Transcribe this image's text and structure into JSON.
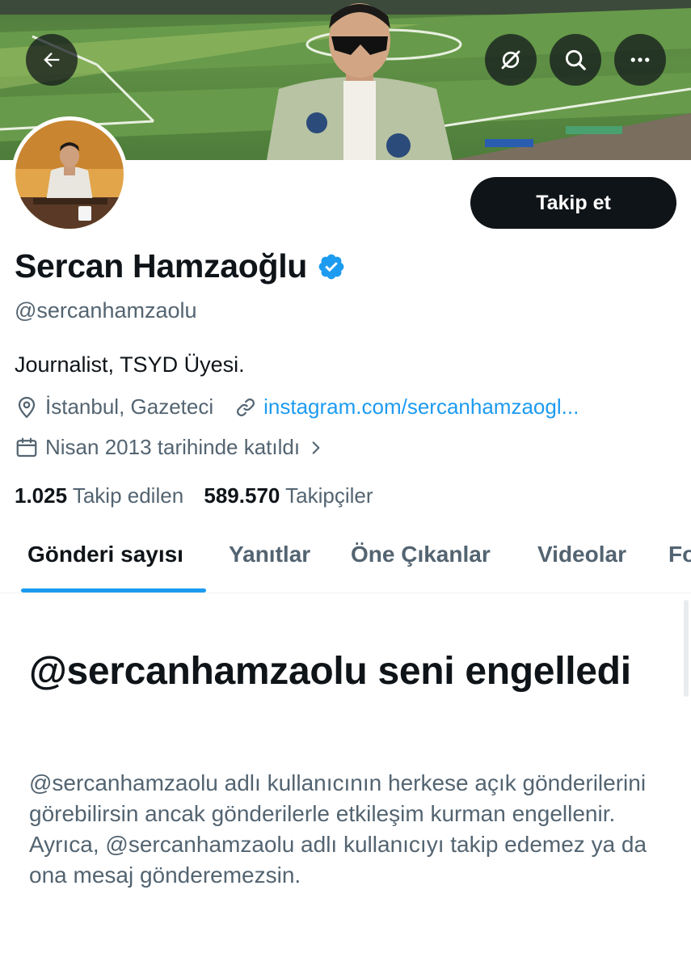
{
  "header": {
    "back_icon": "arrow-left-icon",
    "translate_icon": "no-notifications-icon",
    "search_icon": "search-icon",
    "more_icon": "more-horizontal-icon"
  },
  "profile": {
    "display_name": "Sercan Hamzaoğlu",
    "verified_icon": "verified-badge-icon",
    "handle": "@sercanhamzaolu",
    "bio": "Journalist, TSYD Üyesi.",
    "location": "İstanbul, Gazeteci",
    "website": "instagram.com/sercanhamzaogl...",
    "joined": "Nisan 2013 tarihinde katıldı",
    "following_count": "1.025",
    "following_label": "Takip edilen",
    "followers_count": "589.570",
    "followers_label": "Takipçiler",
    "follow_button": "Takip et"
  },
  "tabs": [
    {
      "label": "Gönderi sayısı",
      "active": true
    },
    {
      "label": "Yanıtlar",
      "active": false
    },
    {
      "label": "Öne Çıkanlar",
      "active": false
    },
    {
      "label": "Videolar",
      "active": false
    },
    {
      "label": "Fo",
      "active": false
    }
  ],
  "blocked": {
    "title": "@sercanhamzaolu seni engelledi",
    "body": "@sercanhamzaolu adlı kullanıcının herkese açık gönderilerini görebilirsin ancak gönderilerle etkileşim kurman engellenir. Ayrıca, @sercanhamzaolu adlı kullanıcıyı takip edemez ya da ona mesaj gönderemezsin."
  },
  "colors": {
    "accent": "#1d9bf0",
    "text_primary": "#0f1419",
    "text_secondary": "#536471",
    "button_dark": "#0f1419"
  }
}
